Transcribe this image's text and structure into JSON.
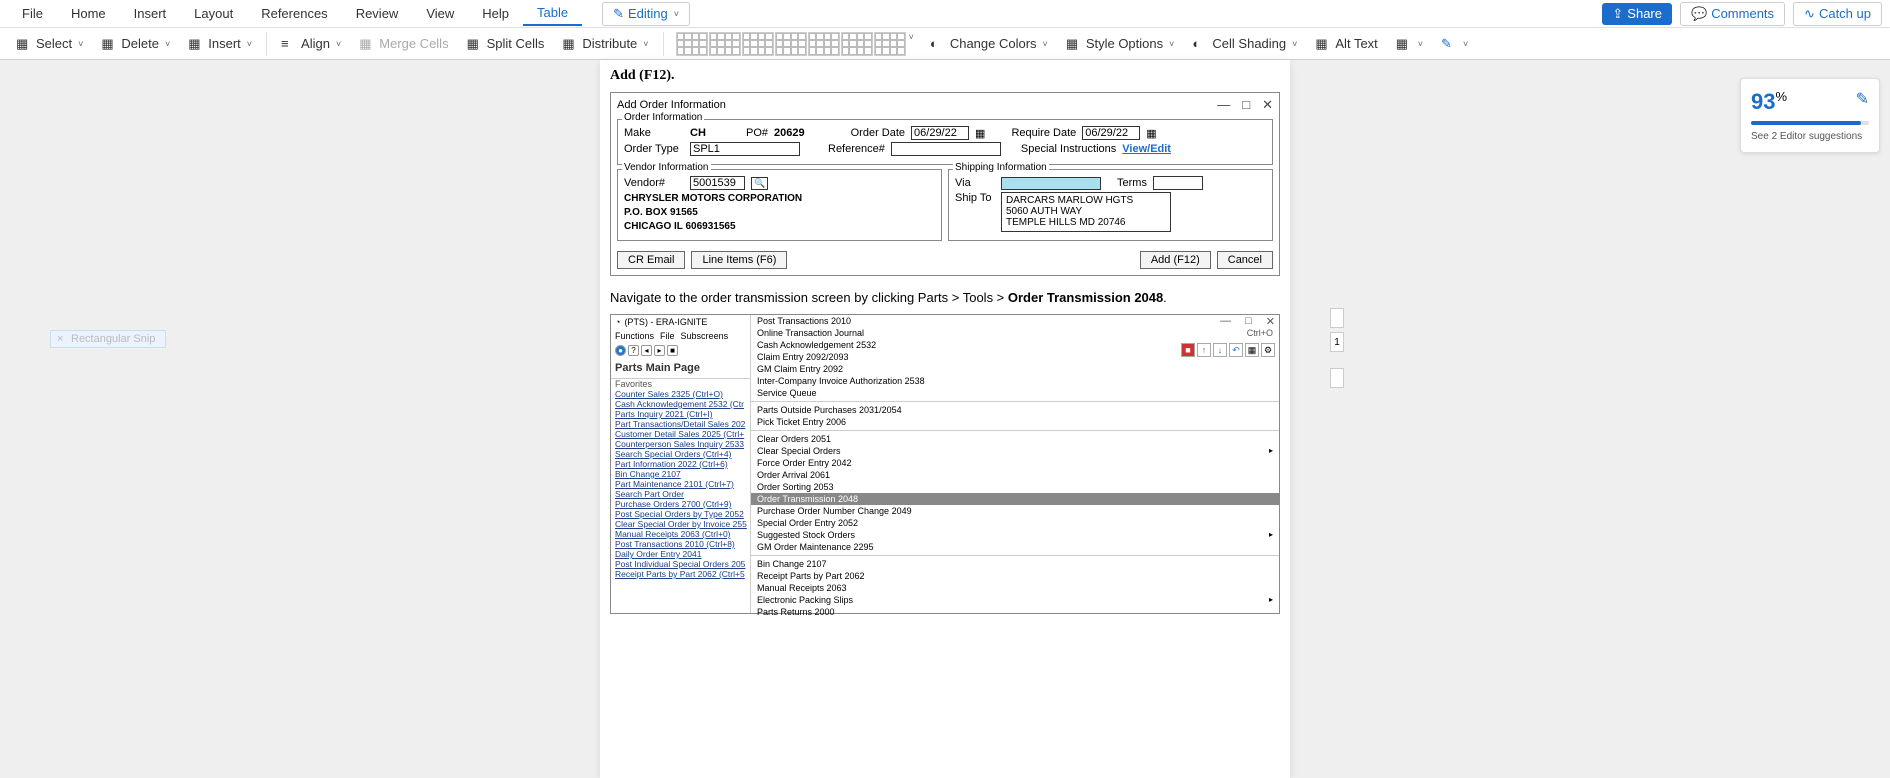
{
  "menu": {
    "items": [
      "File",
      "Home",
      "Insert",
      "Layout",
      "References",
      "Review",
      "View",
      "Help",
      "Table"
    ],
    "active": "Table",
    "editing": "Editing",
    "share": "Share",
    "comments": "Comments",
    "catchup": "Catch up"
  },
  "toolbar": {
    "select": "Select",
    "delete": "Delete",
    "insert": "Insert",
    "align": "Align",
    "merge": "Merge Cells",
    "split": "Split Cells",
    "distribute": "Distribute",
    "change_colors": "Change Colors",
    "style_options": "Style Options",
    "cell_shading": "Cell Shading",
    "alt_text": "Alt Text"
  },
  "doc": {
    "add_heading": "Add (F12).",
    "dlg1": {
      "title": "Add Order Information",
      "order_info": "Order Information",
      "make": "Make",
      "make_val": "CH",
      "po": "PO#",
      "po_val": "20629",
      "order_date": "Order Date",
      "order_date_val": "06/29/22",
      "require_date": "Require Date",
      "require_date_val": "06/29/22",
      "order_type": "Order Type",
      "order_type_val": "SPL1",
      "reference": "Reference#",
      "special": "Special Instructions",
      "viewedit": "View/Edit",
      "vendor_info": "Vendor Information",
      "vendor_no": "Vendor#",
      "vendor_no_val": "5001539",
      "vendor_name": "CHRYSLER MOTORS CORPORATION",
      "vendor_addr1": "P.O. BOX 91565",
      "vendor_addr2": "CHICAGO IL 606931565",
      "ship_info": "Shipping Information",
      "via": "Via",
      "terms": "Terms",
      "ship_to": "Ship To",
      "ship_name": "DARCARS MARLOW HGTS",
      "ship_addr1": "5060 AUTH WAY",
      "ship_addr2": "TEMPLE HILLS MD 20746",
      "cr_email": "CR Email",
      "line_items": "Line Items (F6)",
      "add": "Add (F12)",
      "cancel": "Cancel"
    },
    "nav_text_pre": "Navigate to the order transmission screen by clicking Parts > Tools > ",
    "nav_text_bold": "Order Transmission 2048",
    "app2": {
      "title": "(PTS) - ERA-IGNITE",
      "menus": [
        "Functions",
        "File",
        "Subscreens"
      ],
      "page_title": "Parts Main Page",
      "fav_header": "Favorites",
      "favorites": [
        "Counter Sales 2325 (Ctrl+O)",
        "Cash Acknowledgement 2532 (Ctr",
        "Parts Inquiry 2021 (Ctrl+I)",
        "Part Transactions/Detail Sales 202",
        "Customer Detail Sales 2025 (Ctrl+",
        "Counterperson Sales Inquiry 2533",
        "Search Special Orders (Ctrl+4)",
        "Part Information 2022 (Ctrl+6)",
        "Bin Change 2107",
        "Part Maintenance 2101 (Ctrl+7)",
        "Search Part Order",
        "Purchase Orders 2700 (Ctrl+9)",
        "Post Special Orders by Type 2052",
        "Clear Special Order by Invoice 255",
        "Manual Receipts 2063 (Ctrl+0)",
        "Post Transactions 2010 (Ctrl+8)",
        "Daily Order Entry 2041",
        "Post Individual Special Orders 205",
        "Receipt Parts by Part 2062 (Ctrl+5"
      ],
      "menu_items": [
        {
          "l": "Post Transactions 2010"
        },
        {
          "l": "Online Transaction Journal",
          "s": "Ctrl+O"
        },
        {
          "l": "Cash Acknowledgement 2532"
        },
        {
          "l": "Claim Entry 2092/2093"
        },
        {
          "l": "GM Claim Entry 2092"
        },
        {
          "l": "Inter-Company Invoice Authorization 2538"
        },
        {
          "l": "Service Queue"
        },
        {
          "sep": true
        },
        {
          "l": "Parts Outside Purchases 2031/2054"
        },
        {
          "l": "Pick Ticket Entry 2006"
        },
        {
          "sep": true
        },
        {
          "l": "Clear Orders 2051"
        },
        {
          "l": "Clear Special Orders",
          "sub": true
        },
        {
          "l": "Force Order Entry 2042"
        },
        {
          "l": "Order Arrival 2061"
        },
        {
          "l": "Order Sorting 2053"
        },
        {
          "l": "Order Transmission 2048",
          "sel": true
        },
        {
          "l": "Purchase Order Number Change 2049"
        },
        {
          "l": "Special Order Entry 2052"
        },
        {
          "l": "Suggested Stock Orders",
          "sub": true
        },
        {
          "l": "GM Order Maintenance 2295"
        },
        {
          "sep": true
        },
        {
          "l": "Bin Change 2107"
        },
        {
          "l": "Receipt Parts by Part 2062"
        },
        {
          "l": "Manual Receipts 2063"
        },
        {
          "l": "Electronic Packing Slips",
          "sub": true
        },
        {
          "l": "Parts Returns 2000"
        }
      ]
    }
  },
  "score": {
    "value": "93",
    "pct": "%",
    "suggestion": "See 2 Editor suggestions"
  },
  "snip": "Rectangular Snip",
  "page_no": "1"
}
